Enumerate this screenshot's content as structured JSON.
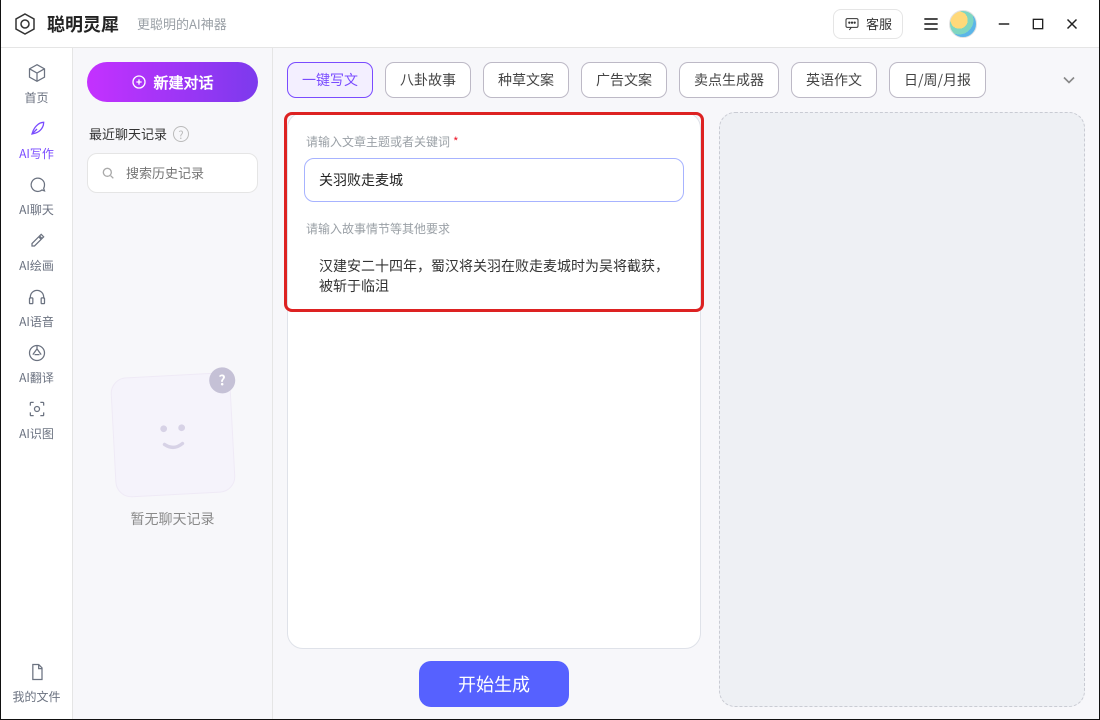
{
  "brand": {
    "name": "聪明灵犀",
    "slogan": "更聪明的AI神器"
  },
  "title_actions": {
    "support_label": "客服"
  },
  "nav": {
    "items": [
      {
        "id": "home",
        "label": "首页"
      },
      {
        "id": "write",
        "label": "AI写作"
      },
      {
        "id": "chat",
        "label": "AI聊天"
      },
      {
        "id": "paint",
        "label": "AI绘画"
      },
      {
        "id": "voice",
        "label": "AI语音"
      },
      {
        "id": "translate",
        "label": "AI翻译"
      },
      {
        "id": "ocr",
        "label": "AI识图"
      }
    ],
    "bottom_item": {
      "id": "files",
      "label": "我的文件"
    }
  },
  "sidebar": {
    "new_label": "新建对话",
    "recent_title": "最近聊天记录",
    "search_placeholder": "搜索历史记录",
    "empty_text": "暂无聊天记录"
  },
  "chips": [
    "一键写文",
    "八卦故事",
    "种草文案",
    "广告文案",
    "卖点生成器",
    "英语作文",
    "日/周/月报"
  ],
  "form": {
    "topic_label": "请输入文章主题或者关键词",
    "topic_value": "关羽败走麦城",
    "plot_label": "请输入故事情节等其他要求",
    "plot_value": "汉建安二十四年，蜀汉将关羽在败走麦城时为吴将截获，被斩于临沮",
    "generate_label": "开始生成"
  }
}
